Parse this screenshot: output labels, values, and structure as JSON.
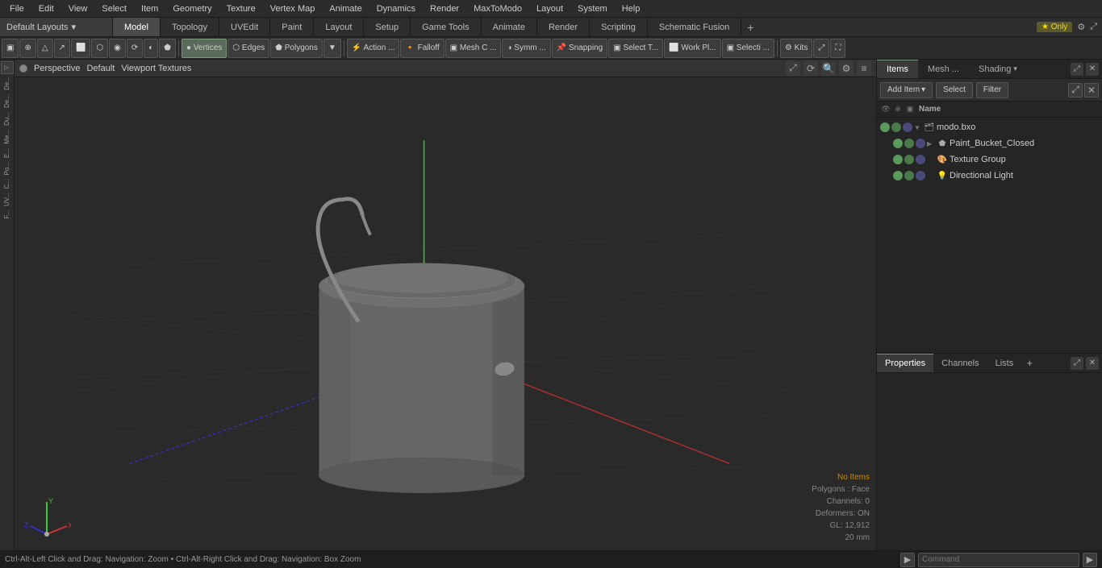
{
  "menubar": {
    "items": [
      "File",
      "Edit",
      "View",
      "Select",
      "Item",
      "Geometry",
      "Texture",
      "Vertex Map",
      "Animate",
      "Dynamics",
      "Render",
      "MaxToModo",
      "Layout",
      "System",
      "Help"
    ]
  },
  "layouts": {
    "dropdown_label": "Default Layouts",
    "dropdown_arrow": "▾",
    "tabs": [
      "Model",
      "Topology",
      "UVEdit",
      "Paint",
      "Layout",
      "Setup",
      "Game Tools",
      "Animate",
      "Render",
      "Scripting",
      "Schematic Fusion"
    ],
    "active_tab": "Model",
    "add_icon": "+",
    "star_label": "★ Only"
  },
  "toolbar": {
    "buttons": [
      {
        "label": "▣",
        "icon": true
      },
      {
        "label": "⊕",
        "icon": true
      },
      {
        "label": "△",
        "icon": true
      },
      {
        "label": "↗",
        "icon": true
      },
      {
        "label": "⬜",
        "icon": true
      },
      {
        "label": "⬡",
        "icon": true
      },
      {
        "label": "◉",
        "icon": true
      },
      {
        "label": "⟳",
        "icon": true
      },
      {
        "label": "◐",
        "icon": true
      },
      {
        "label": "⬟",
        "icon": true
      }
    ],
    "mode_buttons": [
      "Vertices",
      "Edges",
      "Polygons"
    ],
    "tool_buttons": [
      "Action ...",
      "Falloff",
      "Mesh C ...",
      "Symm ...",
      "Snapping",
      "Select T...",
      "Work Pl...",
      "Selecti ...",
      "Kits"
    ]
  },
  "viewport": {
    "header": {
      "dot_active": true,
      "view_type": "Perspective",
      "camera": "Default",
      "shading": "Viewport Textures",
      "icons": [
        "⤢",
        "⟳",
        "🔍",
        "⚙",
        "≡"
      ]
    },
    "status": {
      "no_items": "No Items",
      "polygons": "Polygons : Face",
      "channels": "Channels: 0",
      "deformers": "Deformers: ON",
      "gl": "GL: 12,912",
      "size": "20 mm"
    },
    "bottom_bar_text": "Ctrl-Alt-Left Click and Drag: Navigation: Zoom  •  Ctrl-Alt-Right Click and Drag: Navigation: Box Zoom"
  },
  "right_panel": {
    "tabs": [
      "Items",
      "Mesh ...",
      "Shading"
    ],
    "active_tab": "Items",
    "toolbar": {
      "add_item_label": "Add Item",
      "add_arrow": "▾",
      "select_label": "Select",
      "filter_label": "Filter"
    },
    "col_header": {
      "name_label": "Name"
    },
    "scene_items": [
      {
        "level": 0,
        "label": "modo.bxo",
        "type": "scene",
        "visible": true,
        "has_arrow": true,
        "arrow_open": true
      },
      {
        "level": 1,
        "label": "Paint_Bucket_Closed",
        "type": "mesh",
        "visible": true,
        "has_arrow": true,
        "arrow_open": false
      },
      {
        "level": 1,
        "label": "Texture Group",
        "type": "texture",
        "visible": true,
        "has_arrow": false
      },
      {
        "level": 1,
        "label": "Directional Light",
        "type": "light",
        "visible": true,
        "has_arrow": false
      }
    ]
  },
  "properties_panel": {
    "tabs": [
      "Properties",
      "Channels",
      "Lists"
    ],
    "active_tab": "Properties",
    "add_label": "+"
  },
  "status_bar": {
    "text": "Ctrl-Alt-Left Click and Drag: Navigation: Zoom  •  Ctrl-Alt-Right Click and Drag: Navigation: Box Zoom",
    "command_placeholder": "Command",
    "arrow_label": "▶"
  },
  "left_sidebar": {
    "labels": [
      "De...",
      "De...",
      "Du...",
      "Me...",
      "E...",
      "Po...",
      "C...",
      "UV...",
      "F..."
    ]
  }
}
